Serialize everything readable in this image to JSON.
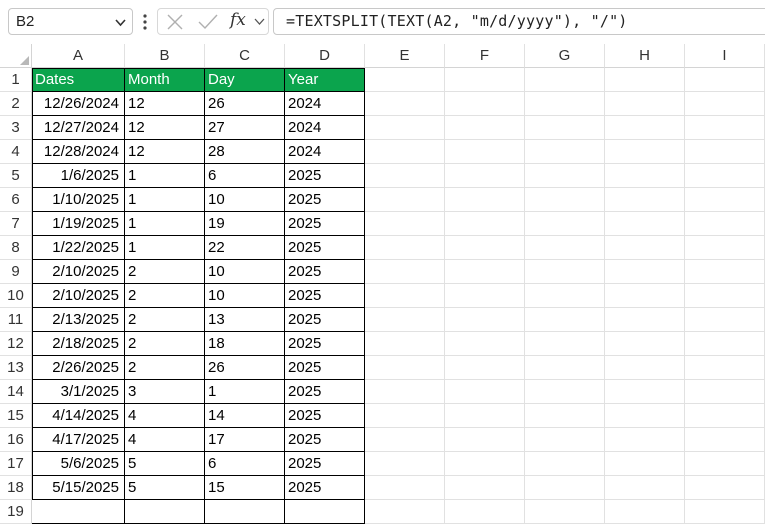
{
  "formula_bar": {
    "name_box": "B2",
    "formula": "=TEXTSPLIT(TEXT(A2, \"m/d/yyyy\"), \"/\")",
    "fx_label": "fx"
  },
  "columns": [
    "A",
    "B",
    "C",
    "D",
    "E",
    "F",
    "G",
    "H",
    "I"
  ],
  "rows": [
    "1",
    "2",
    "3",
    "4",
    "5",
    "6",
    "7",
    "8",
    "9",
    "10",
    "11",
    "12",
    "13",
    "14",
    "15",
    "16",
    "17",
    "18",
    "19"
  ],
  "table": {
    "headers": [
      "Dates",
      "Month",
      "Day",
      "Year"
    ],
    "header_color": "#0ba44d",
    "data": [
      [
        "12/26/2024",
        "12",
        "26",
        "2024"
      ],
      [
        "12/27/2024",
        "12",
        "27",
        "2024"
      ],
      [
        "12/28/2024",
        "12",
        "28",
        "2024"
      ],
      [
        "1/6/2025",
        "1",
        "6",
        "2025"
      ],
      [
        "1/10/2025",
        "1",
        "10",
        "2025"
      ],
      [
        "1/19/2025",
        "1",
        "19",
        "2025"
      ],
      [
        "1/22/2025",
        "1",
        "22",
        "2025"
      ],
      [
        "2/10/2025",
        "2",
        "10",
        "2025"
      ],
      [
        "2/10/2025",
        "2",
        "10",
        "2025"
      ],
      [
        "2/13/2025",
        "2",
        "13",
        "2025"
      ],
      [
        "2/18/2025",
        "2",
        "18",
        "2025"
      ],
      [
        "2/26/2025",
        "2",
        "26",
        "2025"
      ],
      [
        "3/1/2025",
        "3",
        "1",
        "2025"
      ],
      [
        "4/14/2025",
        "4",
        "14",
        "2025"
      ],
      [
        "4/17/2025",
        "4",
        "17",
        "2025"
      ],
      [
        "5/6/2025",
        "5",
        "6",
        "2025"
      ],
      [
        "5/15/2025",
        "5",
        "15",
        "2025"
      ]
    ]
  },
  "icons": {
    "name_box_dropdown": "chevron-down-icon",
    "more_options": "vertical-dots-icon",
    "cancel": "close-icon",
    "enter": "checkmark-icon",
    "insert_function": "fx-icon",
    "select_all": "select-all-triangle-icon"
  }
}
